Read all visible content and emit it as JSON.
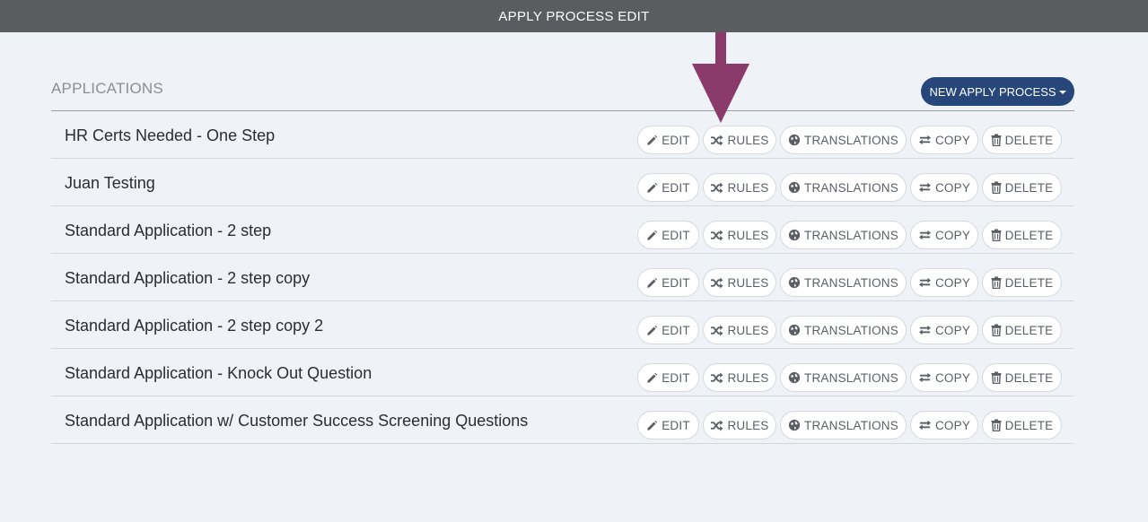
{
  "header": {
    "title": "APPLY PROCESS EDIT"
  },
  "section": {
    "title": "APPLICATIONS",
    "new_button_label": "NEW APPLY PROCESS"
  },
  "action_labels": {
    "edit": "EDIT",
    "rules": "RULES",
    "translations": "TRANSLATIONS",
    "copy": "COPY",
    "delete": "DELETE"
  },
  "applications": [
    {
      "name": "HR Certs Needed - One Step"
    },
    {
      "name": "Juan Testing"
    },
    {
      "name": "Standard Application - 2 step"
    },
    {
      "name": "Standard Application - 2 step copy"
    },
    {
      "name": "Standard Application - 2 step copy 2"
    },
    {
      "name": "Standard Application - Knock Out Question"
    },
    {
      "name": "Standard Application w/ Customer Success Screening Questions"
    }
  ],
  "colors": {
    "topbar": "#5a5c5f",
    "primary_button": "#27477a",
    "annotation_arrow": "#8b3a6c",
    "background": "#eff2f6"
  },
  "icons": {
    "edit": "pencil-icon",
    "rules": "shuffle-icon",
    "translations": "globe-icon",
    "copy": "swap-arrows-icon",
    "delete": "trash-icon"
  }
}
